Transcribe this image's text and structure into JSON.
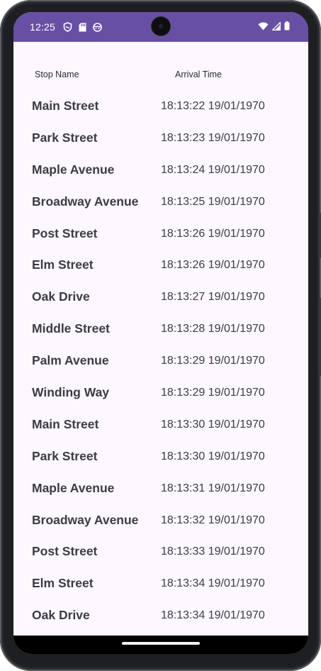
{
  "status_bar": {
    "time": "12:25",
    "icons_left": [
      "shield-icon",
      "sd-card-icon",
      "face-icon"
    ],
    "icons_right": [
      "wifi-icon",
      "signal-icon",
      "battery-icon"
    ],
    "color": "#6750a4"
  },
  "table": {
    "headers": {
      "stop_name": "Stop Name",
      "arrival_time": "Arrival Time"
    },
    "rows": [
      {
        "stop": "Main Street",
        "time": "18:13:22 19/01/1970"
      },
      {
        "stop": "Park Street",
        "time": "18:13:23 19/01/1970"
      },
      {
        "stop": "Maple Avenue",
        "time": "18:13:24 19/01/1970"
      },
      {
        "stop": "Broadway Avenue",
        "time": "18:13:25 19/01/1970"
      },
      {
        "stop": "Post Street",
        "time": "18:13:26 19/01/1970"
      },
      {
        "stop": "Elm Street",
        "time": "18:13:26 19/01/1970"
      },
      {
        "stop": "Oak Drive",
        "time": "18:13:27 19/01/1970"
      },
      {
        "stop": "Middle Street",
        "time": "18:13:28 19/01/1970"
      },
      {
        "stop": "Palm Avenue",
        "time": "18:13:29 19/01/1970"
      },
      {
        "stop": "Winding Way",
        "time": "18:13:29 19/01/1970"
      },
      {
        "stop": "Main Street",
        "time": "18:13:30 19/01/1970"
      },
      {
        "stop": "Park Street",
        "time": "18:13:30 19/01/1970"
      },
      {
        "stop": "Maple Avenue",
        "time": "18:13:31 19/01/1970"
      },
      {
        "stop": "Broadway Avenue",
        "time": "18:13:32 19/01/1970"
      },
      {
        "stop": "Post Street",
        "time": "18:13:33 19/01/1970"
      },
      {
        "stop": "Elm Street",
        "time": "18:13:34 19/01/1970"
      },
      {
        "stop": "Oak Drive",
        "time": "18:13:34 19/01/1970"
      }
    ]
  }
}
